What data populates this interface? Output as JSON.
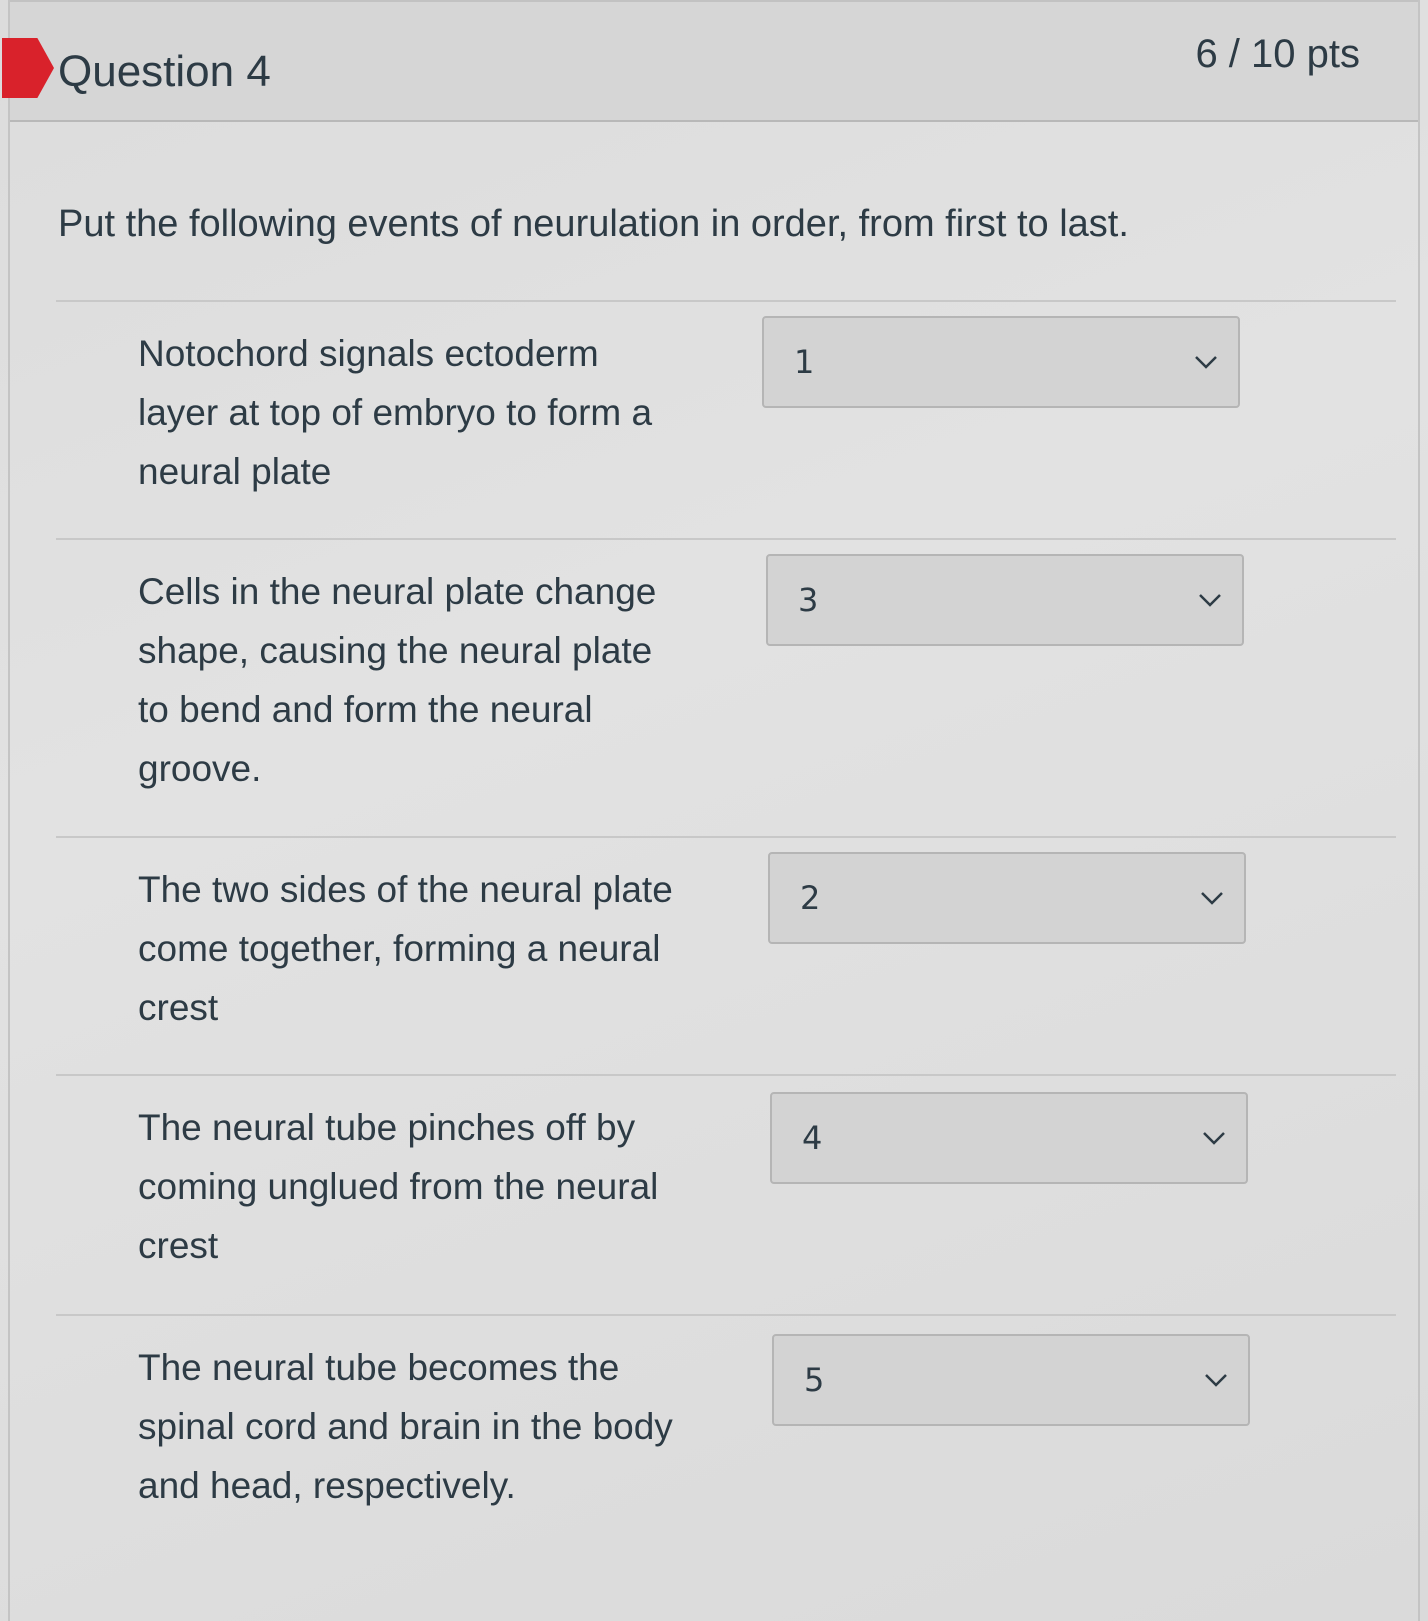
{
  "question": {
    "name": "Question 4",
    "points": "6 / 10 pts",
    "text": "Put the following events of neurulation in order, from first to last.",
    "status_color": "#d9222b"
  },
  "matches": [
    {
      "label": "Notochord signals ectoderm layer at top of embryo to form a neural plate",
      "selected": "1"
    },
    {
      "label": "Cells in the neural plate change shape, causing the neural plate to bend and form the neural groove.",
      "selected": "3"
    },
    {
      "label": "The two sides of the neural plate come together, forming a neural crest",
      "selected": "2"
    },
    {
      "label": "The neural tube pinches off by coming unglued from the neural crest",
      "selected": "4"
    },
    {
      "label": "The neural tube becomes the spinal cord and brain in the body and head, respectively.",
      "selected": "5"
    }
  ],
  "icons": {
    "select_arrow": "chevron-down-icon"
  }
}
